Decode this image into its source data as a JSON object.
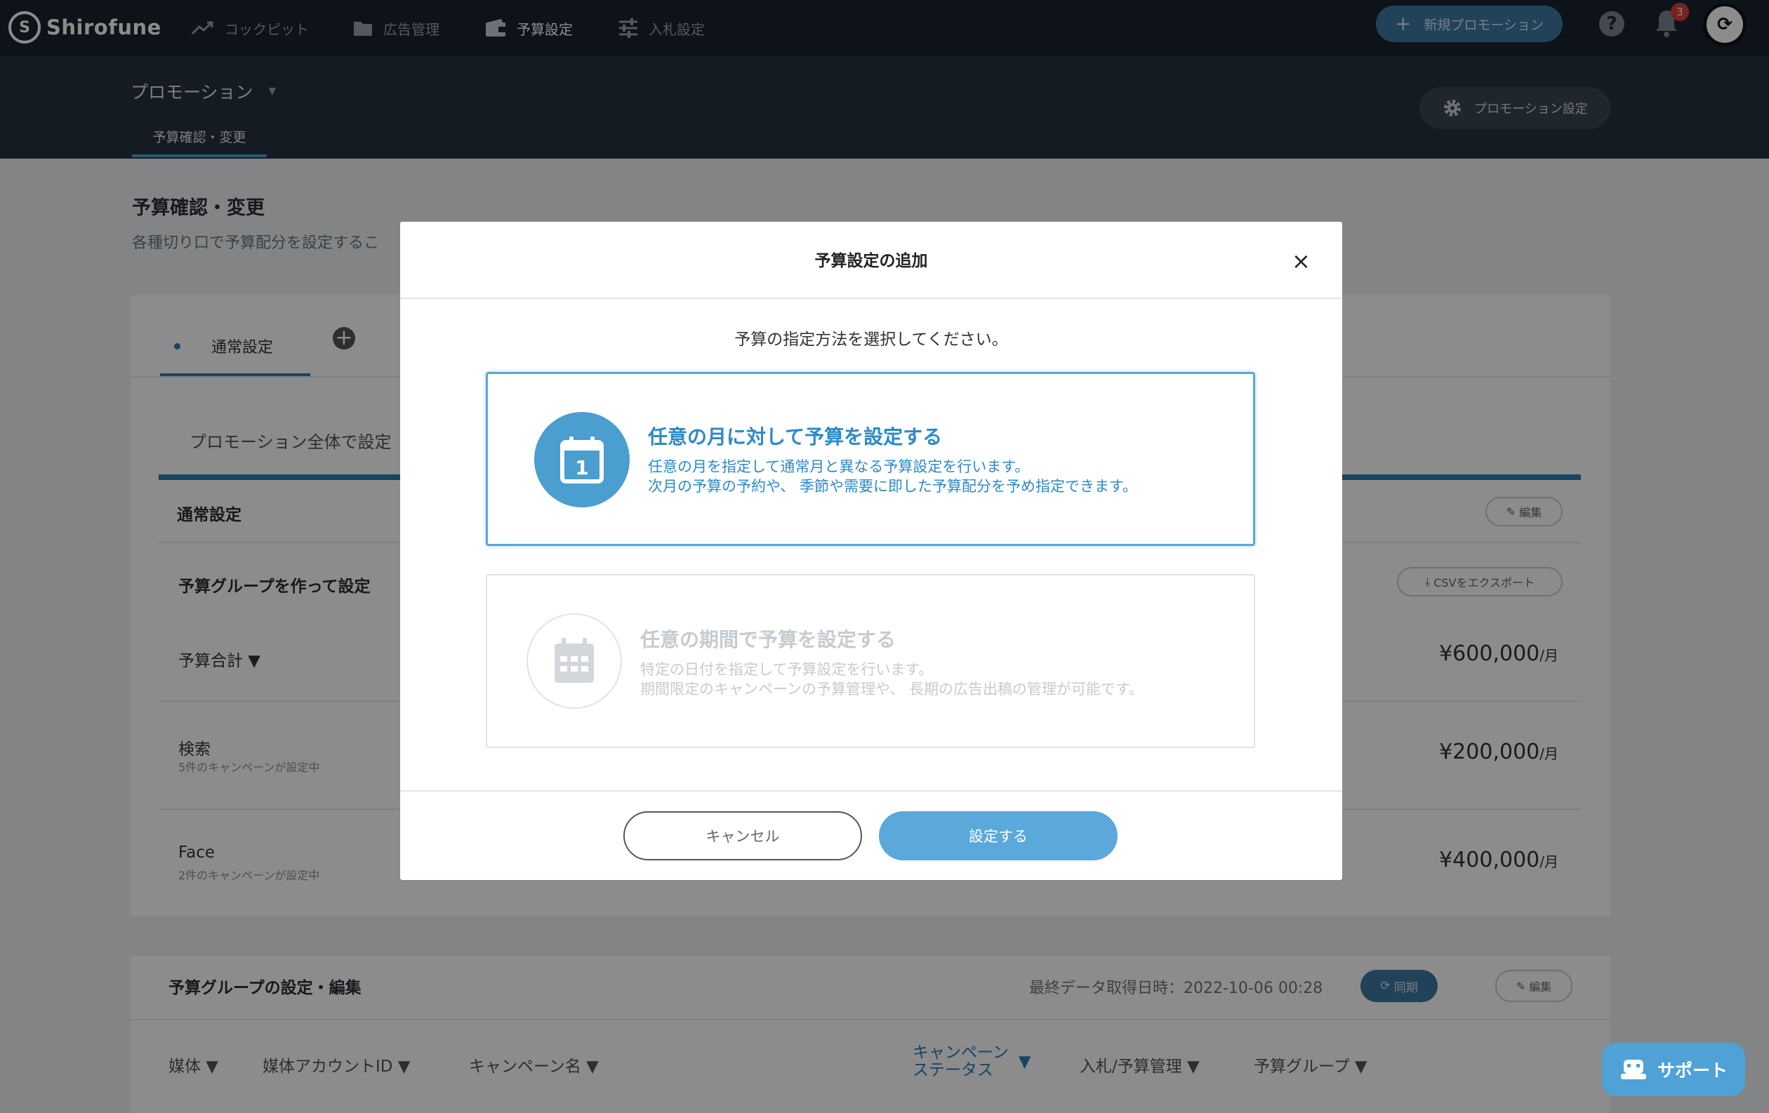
{
  "app": {
    "logo_text": "Shirofune",
    "logo_mark": "S"
  },
  "nav": {
    "items": [
      {
        "label": "コックピット",
        "icon": "trend-icon"
      },
      {
        "label": "広告管理",
        "icon": "folder-icon"
      },
      {
        "label": "予算設定",
        "icon": "wallet-icon"
      },
      {
        "label": "入札設定",
        "icon": "sliders-icon"
      }
    ],
    "new_promotion": "新規プロモーション",
    "notification_count": "3"
  },
  "subheader": {
    "promotion": "プロモーション",
    "tab": "予算確認・変更",
    "settings_button": "プロモーション設定"
  },
  "page": {
    "title": "予算確認・変更",
    "description": "各種切り口で予算配分を設定するこ"
  },
  "budget_card": {
    "tab_label": "通常設定",
    "whole_label": "プロモーション全体で設定",
    "rows": {
      "normal": "通常設定",
      "edit": "編集",
      "group": "予算グループを作って設定",
      "csv_export": "CSVをエクスポート",
      "total": "予算合計 ▼",
      "total_amount": "¥600,000",
      "search": "検索",
      "search_sub": "5件のキャンペーンが設定中",
      "search_amount": "¥200,000",
      "face": "Face",
      "face_sub": "2件のキャンペーンが設定中",
      "face_amount": "¥400,000",
      "unit": "/月"
    }
  },
  "group_card": {
    "title": "予算グループの設定・編集",
    "last_data": "最終データ取得日時：2022-10-06 00:28",
    "sync": "同期",
    "edit": "編集",
    "columns": [
      "媒体 ▼",
      "媒体アカウントID ▼",
      "キャンペーン名 ▼",
      "入札/予算管理 ▼",
      "予算グループ ▼"
    ],
    "status_line1": "キャンペーン",
    "status_line2": "ステータス",
    "status_caret": "▼"
  },
  "modal": {
    "title": "予算設定の追加",
    "close": "×",
    "prompt": "予算の指定方法を選択してください。",
    "options": [
      {
        "title": "任意の月に対して予算を設定する",
        "desc1": "任意の月を指定して通常月と異なる予算設定を行います。",
        "desc2": "次月の予算の予約や、 季節や需要に即した予算配分を予め指定できます。",
        "icon_text": "1",
        "selected": true
      },
      {
        "title": "任意の期間で予算を設定する",
        "desc1": "特定の日付を指定して予算設定を行います。",
        "desc2": "期間限定のキャンペーンの予算管理や、 長期の広告出稿の管理が可能です。",
        "selected": false
      }
    ],
    "cancel": "キャンセル",
    "confirm": "設定する"
  },
  "support": {
    "label": "サポート"
  },
  "colors": {
    "accent": "#2d7cb5",
    "modal_selected": "#5aa7d6",
    "topbar": "#1a232e"
  }
}
